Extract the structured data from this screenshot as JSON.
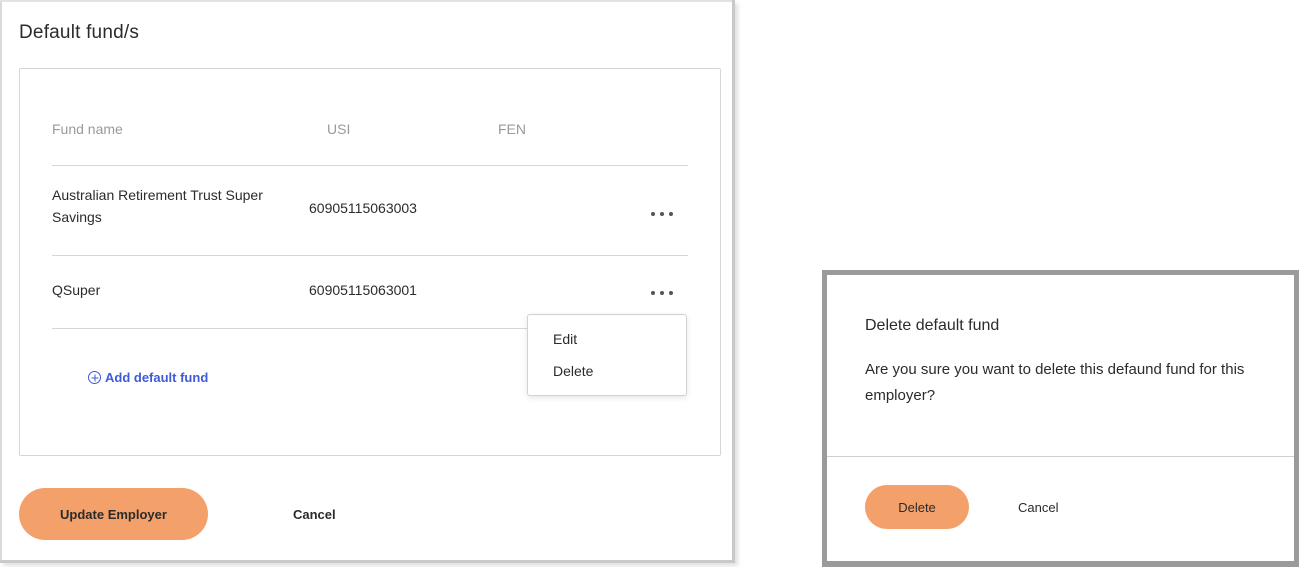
{
  "section": {
    "title": "Default fund/s"
  },
  "table": {
    "headers": {
      "fund_name": "Fund name",
      "usi": "USI",
      "fen": "FEN"
    },
    "rows": [
      {
        "fund_name": "Australian Retirement Trust Super Savings",
        "usi": "60905115063003",
        "fen": ""
      },
      {
        "fund_name": "QSuper",
        "usi": "60905115063001",
        "fen": ""
      }
    ]
  },
  "add_fund_label": "Add default fund",
  "row_menu": {
    "items": [
      "Edit",
      "Delete"
    ]
  },
  "actions": {
    "update_label": "Update Employer",
    "cancel_label": "Cancel"
  },
  "dialog": {
    "title": "Delete default fund",
    "message": "Are you sure you want to delete this defaund fund for this employer?",
    "confirm_label": "Delete",
    "cancel_label": "Cancel"
  },
  "colors": {
    "accent": "#f4a06a",
    "link": "#3d5bd9",
    "border": "#d6d6d6",
    "muted_text": "#9a9a9a"
  },
  "icons": {
    "add": "plus-circle-icon",
    "more": "more-horizontal-icon"
  }
}
